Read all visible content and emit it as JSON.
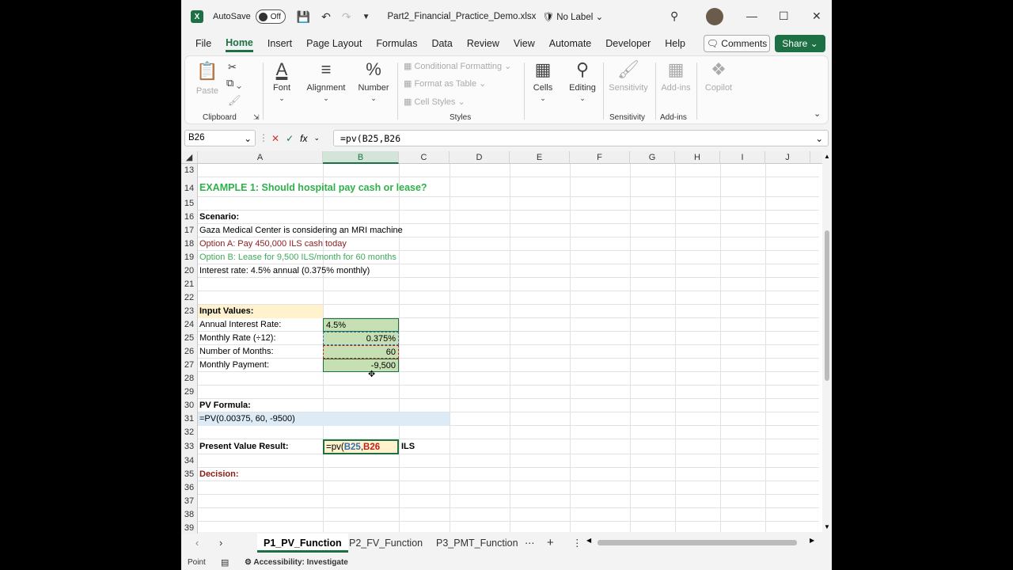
{
  "titlebar": {
    "autosave_label": "AutoSave",
    "autosave_state": "Off",
    "filename": "Part2_Financial_Practice_Demo.xlsx",
    "sensitivity_label": "No Label"
  },
  "menu": {
    "items": [
      "File",
      "Home",
      "Insert",
      "Page Layout",
      "Formulas",
      "Data",
      "Review",
      "View",
      "Automate",
      "Developer",
      "Help"
    ],
    "active": "Home",
    "comments_label": "Comments",
    "share_label": "Share"
  },
  "ribbon": {
    "paste": "Paste",
    "clipboard": "Clipboard",
    "font": "Font",
    "alignment": "Alignment",
    "number": "Number",
    "conditional_formatting": "Conditional Formatting",
    "format_as_table": "Format as Table",
    "cell_styles": "Cell Styles",
    "styles": "Styles",
    "cells": "Cells",
    "editing": "Editing",
    "sensitivity": "Sensitivity",
    "sensitivity_group": "Sensitivity",
    "addins": "Add-ins",
    "addins_group": "Add-ins",
    "copilot": "Copilot"
  },
  "formula_bar": {
    "name_box": "B26",
    "formula": "=pv(B25,B26"
  },
  "columns": [
    "A",
    "B",
    "C",
    "D",
    "E",
    "F",
    "G",
    "H",
    "I",
    "J"
  ],
  "rows": {
    "r13": {
      "num": "13"
    },
    "r14": {
      "num": "14",
      "a": "EXAMPLE 1: Should hospital pay cash or lease?"
    },
    "r15": {
      "num": "15"
    },
    "r16": {
      "num": "16",
      "a": "Scenario:"
    },
    "r17": {
      "num": "17",
      "a": "Gaza Medical Center is considering an MRI machine"
    },
    "r18": {
      "num": "18",
      "a": "Option A: Pay 450,000 ILS cash today"
    },
    "r19": {
      "num": "19",
      "a": "Option B: Lease for 9,500 ILS/month for 60 months"
    },
    "r20": {
      "num": "20",
      "a": "Interest rate: 4.5% annual (0.375% monthly)"
    },
    "r21": {
      "num": "21"
    },
    "r22": {
      "num": "22"
    },
    "r23": {
      "num": "23",
      "a": "Input Values:"
    },
    "r24": {
      "num": "24",
      "a": "Annual Interest Rate:",
      "b": "4.5%"
    },
    "r25": {
      "num": "25",
      "a": "Monthly Rate (÷12):",
      "b": "0.375%"
    },
    "r26": {
      "num": "26",
      "a": "Number of Months:",
      "b": "60"
    },
    "r27": {
      "num": "27",
      "a": "Monthly Payment:",
      "b": "-9,500"
    },
    "r28": {
      "num": "28"
    },
    "r29": {
      "num": "29"
    },
    "r30": {
      "num": "30",
      "a": "PV Formula:"
    },
    "r31": {
      "num": "31",
      "a": "=PV(0.00375, 60, -9500)"
    },
    "r32": {
      "num": "32"
    },
    "r33": {
      "num": "33",
      "a": "Present Value Result:",
      "b_prefix": "=pv(",
      "b_ref1": "B25",
      "b_comma": ",",
      "b_ref2": "B26",
      "c": "ILS"
    },
    "r34": {
      "num": "34"
    },
    "r35": {
      "num": "35",
      "a": "Decision:"
    },
    "r36": {
      "num": "36"
    },
    "r37": {
      "num": "37"
    },
    "r38": {
      "num": "38"
    },
    "r39": {
      "num": "39"
    }
  },
  "sheets": {
    "tab1": "P1_PV_Function",
    "tab2": "P2_FV_Function",
    "tab3": "P3_PMT_Function"
  },
  "status": {
    "mode": "Point",
    "accessibility": "Accessibility: Investigate"
  },
  "colors": {
    "excel_green": "#1d7044",
    "heading_green": "#2fb14a",
    "option_a_red": "#8b1a1a",
    "option_b_green": "#3daa5b",
    "input_fill": "#c6e0b4",
    "input_label_fill": "#fff2cc",
    "formula_row_fill": "#ddebf7"
  }
}
